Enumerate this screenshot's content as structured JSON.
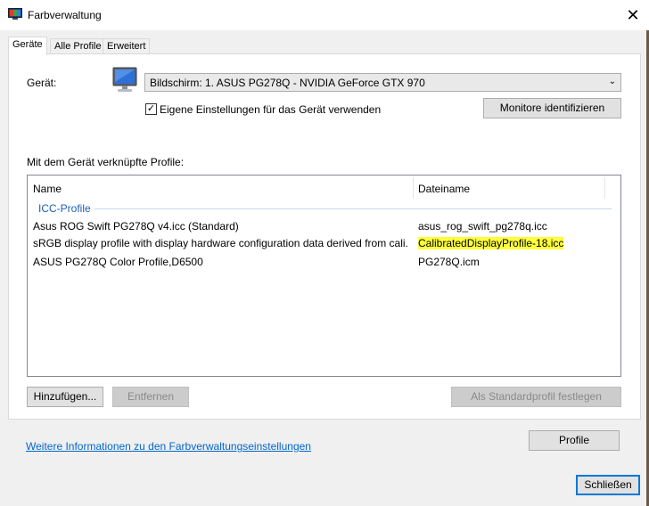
{
  "window": {
    "title": "Farbverwaltung",
    "close_glyph": "✕"
  },
  "tabs": [
    {
      "label": "Geräte",
      "active": true
    },
    {
      "label": "Alle Profile",
      "active": false
    },
    {
      "label": "Erweitert",
      "active": false
    }
  ],
  "device": {
    "label": "Gerät:",
    "icon": "monitor-icon",
    "selected": "Bildschirm: 1. ASUS PG278Q - NVIDIA GeForce GTX 970",
    "checkbox_label": "Eigene Einstellungen für das Gerät verwenden",
    "checkbox_checked": true,
    "identify_button": "Monitore identifizieren"
  },
  "profiles": {
    "section_label": "Mit dem Gerät verknüpfte Profile:",
    "columns": [
      "Name",
      "Dateiname"
    ],
    "group_label": "ICC-Profile",
    "rows": [
      {
        "name": "Asus ROG Swift PG278Q v4.icc (Standard)",
        "file": "asus_rog_swift_pg278q.icc",
        "highlighted": false
      },
      {
        "name": "sRGB display profile with display hardware configuration data derived from cali...",
        "file": "CalibratedDisplayProfile-18.icc",
        "highlighted": true
      },
      {
        "name": "ASUS PG278Q Color Profile,D6500",
        "file": "PG278Q.icm",
        "highlighted": false
      }
    ]
  },
  "buttons": {
    "add": "Hinzufügen...",
    "remove": "Entfernen",
    "set_default": "Als Standardprofil festlegen",
    "profile": "Profile",
    "close": "Schließen"
  },
  "link": "Weitere Informationen zu den Farbverwaltungseinstellungen",
  "colors": {
    "highlight": "#ffff3a",
    "link": "#0066cc",
    "group_label": "#1e5fb4",
    "accent": "#0078d7"
  }
}
